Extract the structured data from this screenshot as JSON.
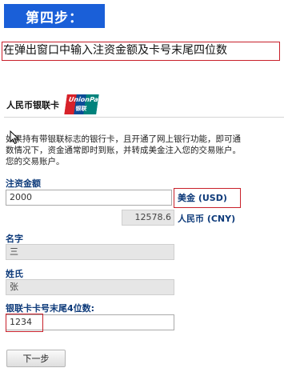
{
  "step": {
    "label": "第四步："
  },
  "instruction": "在弹出窗口中输入注资金额及卡号末尾四位数",
  "card": {
    "title": "人民币银联卡",
    "logo": {
      "line1": "UnionPay",
      "line2": "银联"
    }
  },
  "description": [
    "如果持有带银联标志的银行卡，且开通了网上银行功能，即可通",
    "数情况下，资金通常即时到账，并转成美金注入您的交易账户。",
    "您的交易账户。"
  ],
  "form": {
    "amount": {
      "label": "注资金额",
      "value": "2000",
      "currency": "美金 (USD)"
    },
    "converted": {
      "value": "12578.6",
      "currency": "人民币 (CNY)"
    },
    "first_name": {
      "label": "名字",
      "value": "三"
    },
    "last_name": {
      "label": "姓氏",
      "value": "张"
    },
    "card_last4": {
      "label": "银联卡卡号末尾4位数:",
      "value": "1234"
    },
    "submit_label": "下一步"
  },
  "colors": {
    "badge": "#1a5fd8",
    "highlight": "#c8202a",
    "label": "#0d3a7a",
    "unionpay_red": "#d7222a",
    "unionpay_blue": "#0c4c97",
    "unionpay_teal": "#00827c"
  },
  "icons": {
    "pointer": "mouse-pointer-icon"
  }
}
